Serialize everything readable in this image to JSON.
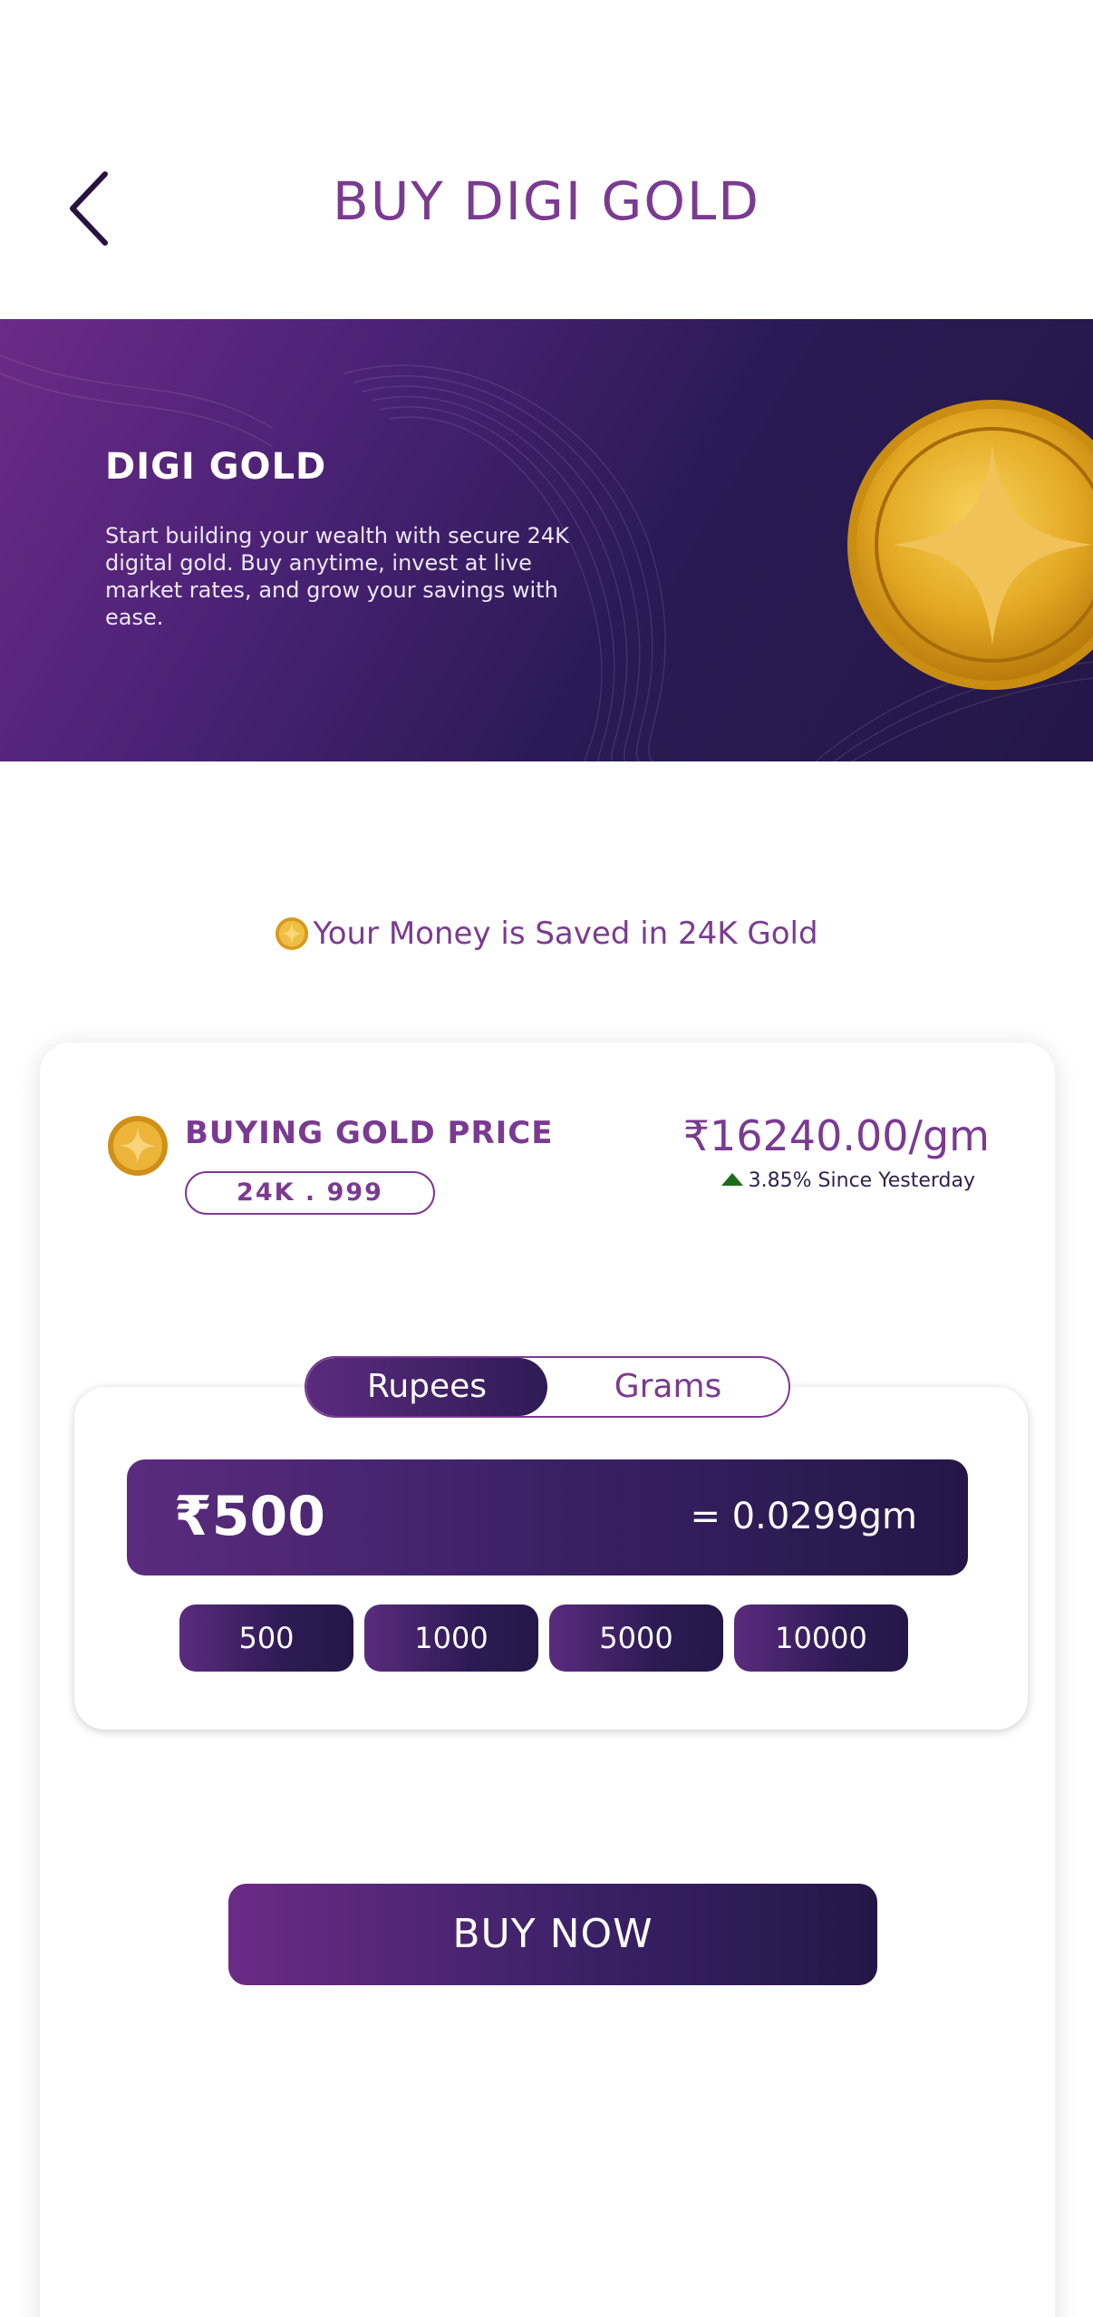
{
  "header": {
    "title": "BUY DIGI GOLD"
  },
  "banner": {
    "title": "DIGI GOLD",
    "text": "Start building your wealth with secure 24K digital gold. Buy anytime, invest at live market rates, and grow your savings with ease."
  },
  "saved_line": "Your Money is Saved in 24K Gold",
  "price": {
    "label": "BUYING GOLD PRICE",
    "purity": "24K . 999",
    "value": "₹16240.00/gm",
    "change": "3.85% Since Yesterday"
  },
  "tabs": [
    {
      "label": "Rupees",
      "active": true
    },
    {
      "label": "Grams",
      "active": false
    }
  ],
  "amount": {
    "value": "₹500",
    "grams": "= 0.0299gm"
  },
  "quick_amounts": [
    "500",
    "1000",
    "5000",
    "10000"
  ],
  "buy_button": "BUY NOW",
  "colors": {
    "accent": "#7b3a91",
    "dark": "#241747",
    "gold": "#e3a823",
    "up": "#1b6d1b"
  }
}
